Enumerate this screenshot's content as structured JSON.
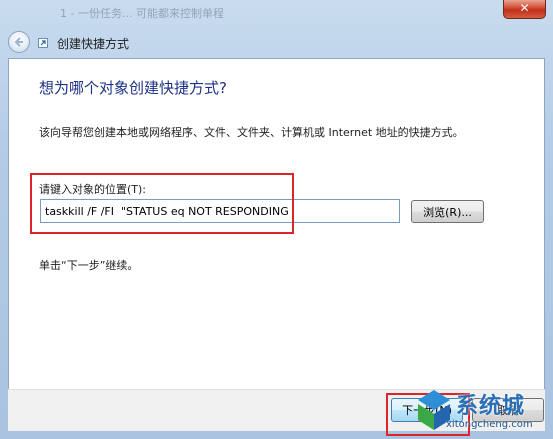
{
  "window": {
    "title_bar_text": "1 - 一份任务... 可能都来控制单程",
    "close_glyph": "✕"
  },
  "nav": {
    "title": "创建快捷方式",
    "back_icon": "back-arrow-icon"
  },
  "wizard": {
    "heading": "想为哪个对象创建快捷方式?",
    "description": "该向导帮您创建本地或网络程序、文件、文件夹、计算机或 Internet 地址的快捷方式。",
    "location_label": "请键入对象的位置(T):",
    "location_value": "taskkill /F /FI  \"STATUS eq NOT RESPONDING",
    "browse_label": "浏览(R)...",
    "hint": "单击“下一步”继续。"
  },
  "footer": {
    "next_label": "下一步(N)",
    "cancel_label": "取消"
  },
  "watermark": {
    "brand_cn": "系统城",
    "brand_en": "xitongcheng.com"
  },
  "colors": {
    "annotation_red": "#d8262b",
    "heading_blue": "#1e3287",
    "watermark_blue": "#2a6fb5"
  }
}
